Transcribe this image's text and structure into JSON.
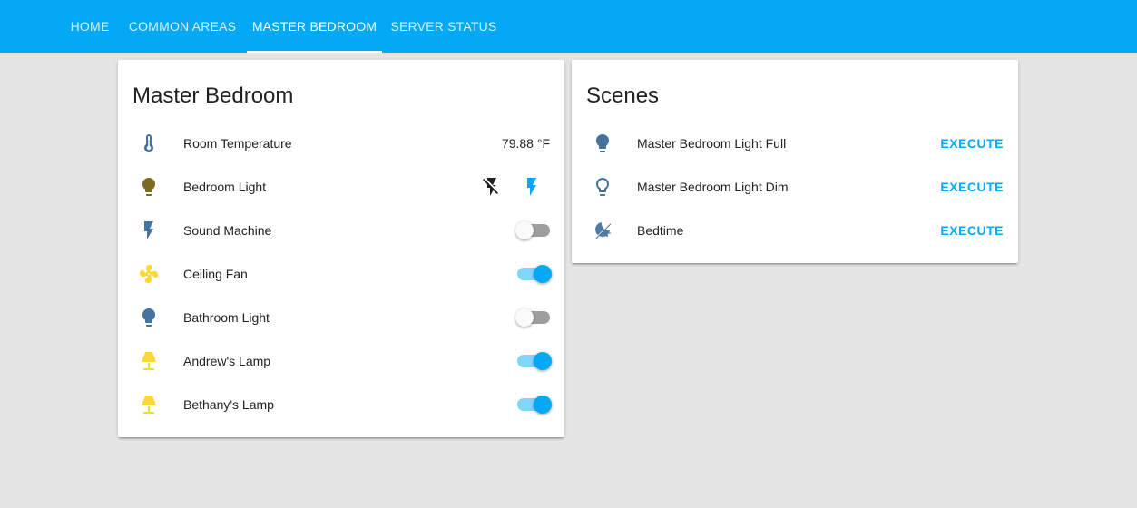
{
  "tabs": [
    {
      "label": "HOME"
    },
    {
      "label": "COMMON AREAS"
    },
    {
      "label": "MASTER BEDROOM"
    },
    {
      "label": "SERVER STATUS"
    }
  ],
  "active_tab": "MASTER BEDROOM",
  "colors": {
    "accent": "#03a9f4",
    "icon_off": "#44739e",
    "icon_on": "#fdd835",
    "icon_bulb_dim": "#7a6a22"
  },
  "master_bedroom": {
    "title": "Master Bedroom",
    "entities": [
      {
        "name": "Room Temperature",
        "icon": "thermometer-icon",
        "value": "79.88 °F"
      },
      {
        "name": "Bedroom Light",
        "icon": "lightbulb-icon",
        "controls": [
          "flash-off-icon",
          "flash-icon"
        ]
      },
      {
        "name": "Sound Machine",
        "icon": "flash-icon",
        "state": "off"
      },
      {
        "name": "Ceiling Fan",
        "icon": "fan-icon",
        "state": "on"
      },
      {
        "name": "Bathroom Light",
        "icon": "lightbulb-icon",
        "state": "off"
      },
      {
        "name": "Andrew's Lamp",
        "icon": "lamp-icon",
        "state": "on"
      },
      {
        "name": "Bethany's Lamp",
        "icon": "lamp-icon",
        "state": "on"
      }
    ]
  },
  "scenes": {
    "title": "Scenes",
    "action_label": "EXECUTE",
    "items": [
      {
        "name": "Master Bedroom Light Full",
        "icon": "lightbulb-icon"
      },
      {
        "name": "Master Bedroom Light Dim",
        "icon": "lightbulb-outline-icon"
      },
      {
        "name": "Bedtime",
        "icon": "weather-night-icon"
      }
    ]
  }
}
